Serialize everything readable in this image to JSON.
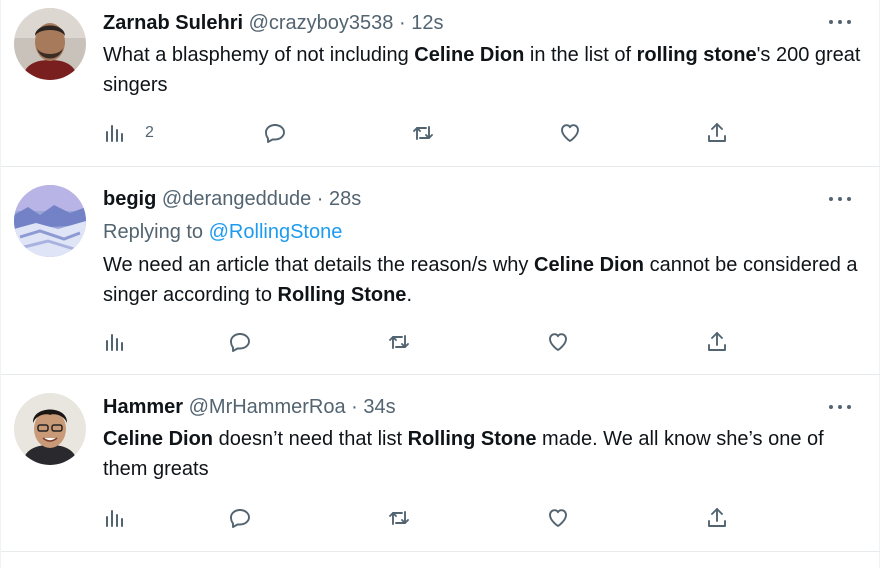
{
  "tweets": [
    {
      "name": "Zarnab Sulehri",
      "handle": "@crazyboy3538",
      "separator": "·",
      "time": "12s",
      "replying_prefix": "",
      "replying_to": "",
      "body": [
        {
          "text": "What a blasphemy of not including ",
          "bold": false
        },
        {
          "text": "Celine Dion",
          "bold": true
        },
        {
          "text": " in the list of ",
          "bold": false
        },
        {
          "text": "rolling stone",
          "bold": true
        },
        {
          "text": "'s 200 great singers",
          "bold": false
        }
      ],
      "views": "2"
    },
    {
      "name": "begig",
      "handle": "@derangeddude",
      "separator": "·",
      "time": "28s",
      "replying_prefix": "Replying to ",
      "replying_to": "@RollingStone",
      "body": [
        {
          "text": "We need an article that details the reason/s why ",
          "bold": false
        },
        {
          "text": "Celine Dion",
          "bold": true
        },
        {
          "text": " cannot be considered a singer according to ",
          "bold": false
        },
        {
          "text": "Rolling Stone",
          "bold": true
        },
        {
          "text": ".",
          "bold": false
        }
      ],
      "views": ""
    },
    {
      "name": "Hammer",
      "handle": "@MrHammerRoa",
      "separator": "·",
      "time": "34s",
      "replying_prefix": "",
      "replying_to": "",
      "body": [
        {
          "text": "Celine Dion",
          "bold": true
        },
        {
          "text": " doesn’t need that list ",
          "bold": false
        },
        {
          "text": "Rolling Stone",
          "bold": true
        },
        {
          "text": " made. We all know she’s one of them greats",
          "bold": false
        }
      ],
      "views": ""
    }
  ],
  "icons": {
    "views": "bar-chart-icon",
    "reply": "speech-bubble-icon",
    "retweet": "retweet-icon",
    "like": "heart-icon",
    "share": "share-icon",
    "more": "more-horizontal-icon"
  },
  "colors": {
    "text": "#0f1419",
    "secondary": "#536471",
    "link": "#1d9bf0",
    "divider": "#e7ebed"
  }
}
